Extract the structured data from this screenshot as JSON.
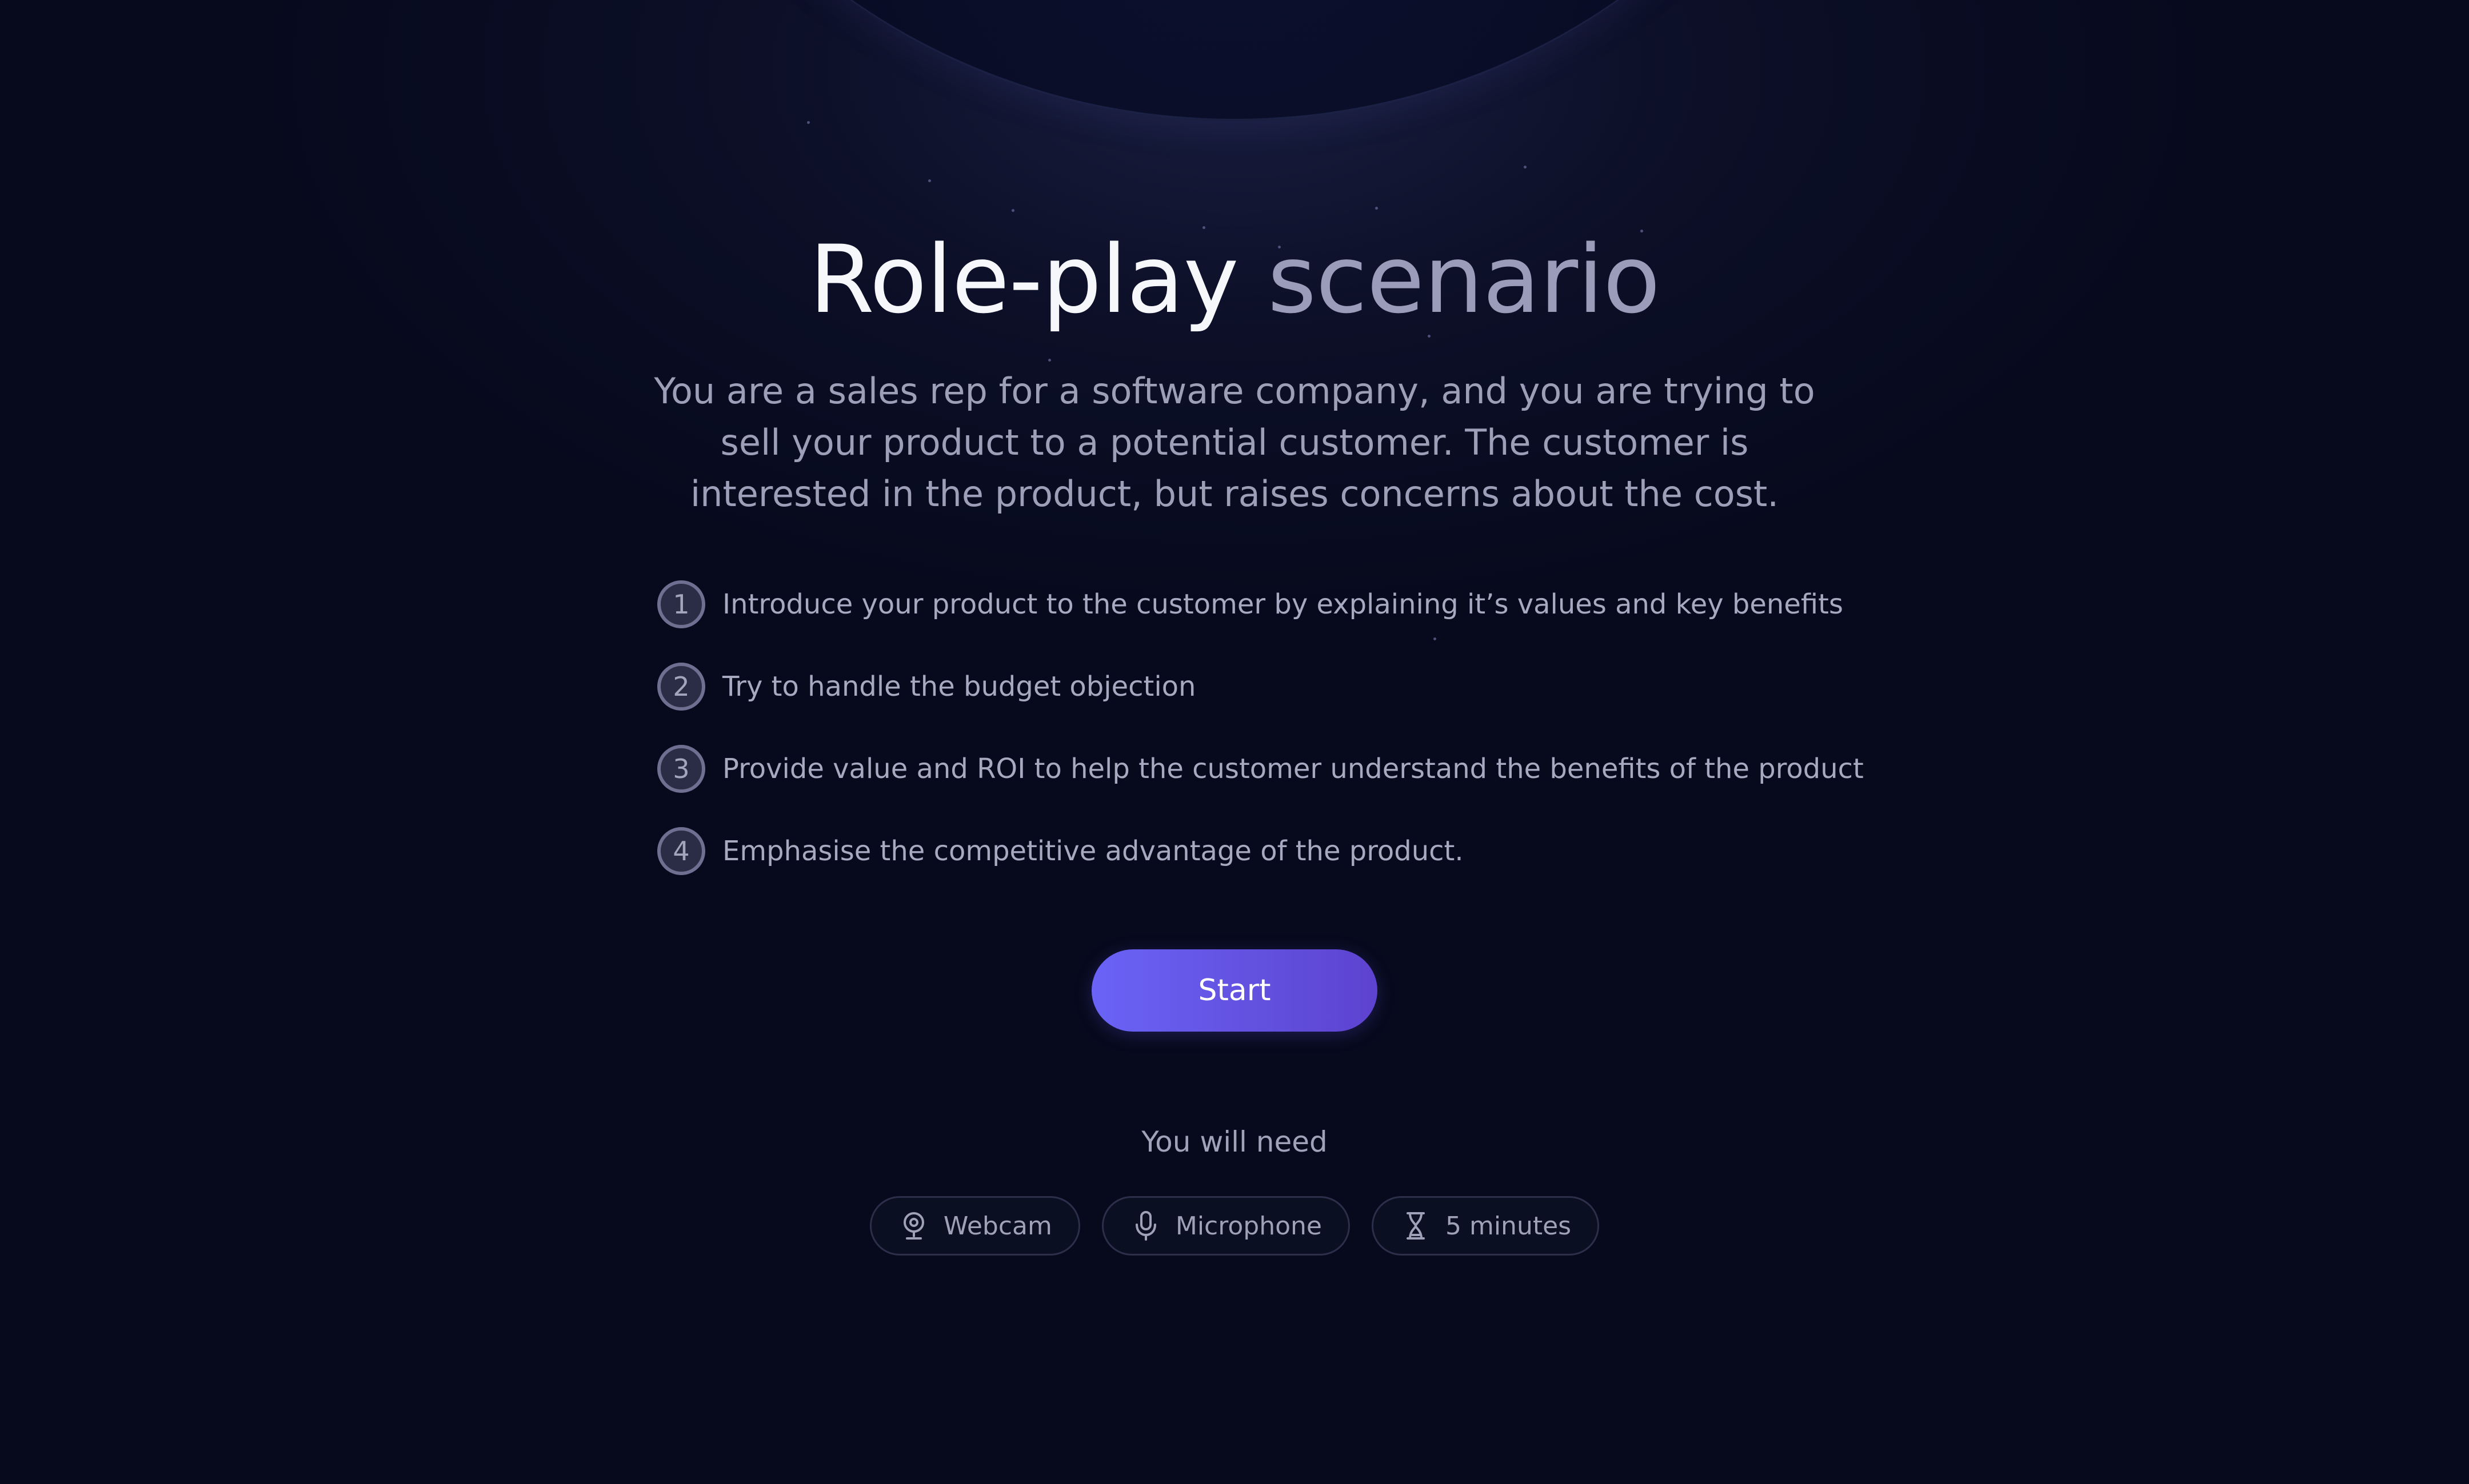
{
  "header": {
    "title_part1": "Role-play",
    "title_part2": "scenario",
    "description": "You are a sales rep for a software company, and you are trying to sell your product to a potential customer. The customer is interested in the product, but raises concerns about the cost."
  },
  "steps": [
    {
      "number": "1",
      "text": "Introduce your product to the customer by explaining it’s values and key benefits"
    },
    {
      "number": "2",
      "text": "Try to handle the budget objection"
    },
    {
      "number": "3",
      "text": "Provide value and ROI to help the customer understand the benefits of the product"
    },
    {
      "number": "4",
      "text": "Emphasise the competitive advantage of the product."
    }
  ],
  "actions": {
    "start_label": "Start"
  },
  "requirements": {
    "label": "You will need",
    "items": [
      {
        "icon": "webcam-icon",
        "label": "Webcam"
      },
      {
        "icon": "microphone-icon",
        "label": "Microphone"
      },
      {
        "icon": "hourglass-icon",
        "label": "5 minutes"
      }
    ]
  },
  "colors": {
    "background": "#070a1d",
    "accent_start": "#6a63f6",
    "accent_end": "#5d43cf",
    "title_primary": "#f6f7fb",
    "title_secondary": "#9b9cb9"
  }
}
